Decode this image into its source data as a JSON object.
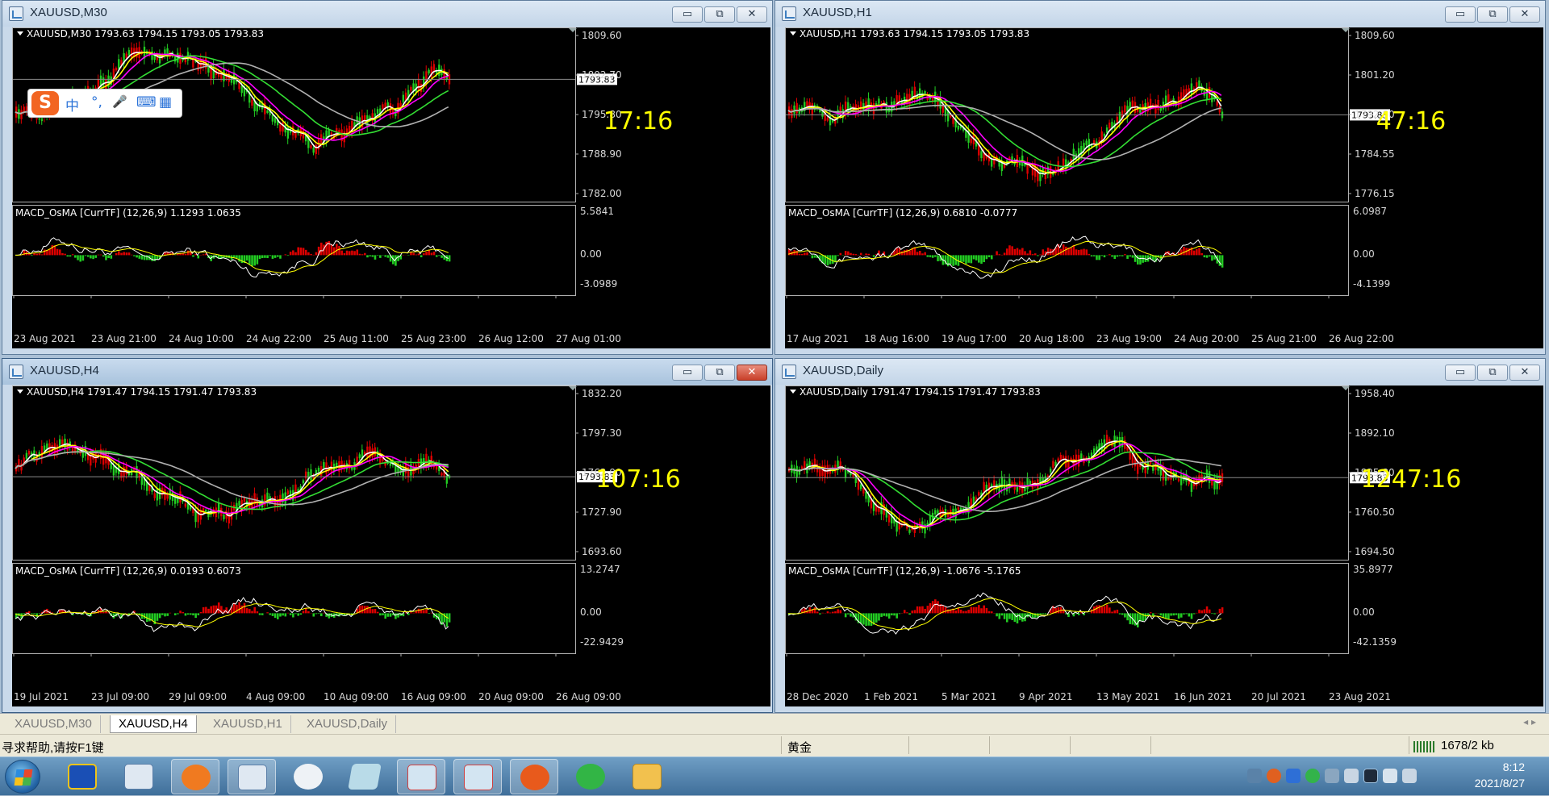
{
  "windows": [
    {
      "id": "m30",
      "title": "XAUUSD,M30",
      "active": false,
      "price_header": "XAUUSD,M30  1793.63 1794.15 1793.05 1793.83",
      "countdown": "17:16",
      "price_ticks": [
        "1809.60",
        "1802.70",
        "1795.80",
        "1788.90",
        "1782.00"
      ],
      "current_price": "1793.83",
      "macd_header": "MACD_OsMA [CurrTF] (12,26,9) 1.1293 1.0635",
      "macd_ticks": [
        "5.5841",
        "0.00",
        "-3.0989"
      ],
      "time_labels": [
        "23 Aug 2021",
        "23 Aug 21:00",
        "24 Aug 10:00",
        "24 Aug 22:00",
        "25 Aug 11:00",
        "25 Aug 23:00",
        "26 Aug 12:00",
        "27 Aug 01:00"
      ]
    },
    {
      "id": "h1",
      "title": "XAUUSD,H1",
      "active": false,
      "price_header": "XAUUSD,H1  1793.63 1794.15 1793.05 1793.83",
      "countdown": "47:16",
      "price_ticks": [
        "1809.60",
        "1801.20",
        "1792.80",
        "1784.55",
        "1776.15"
      ],
      "current_price": "1793.83",
      "macd_header": "MACD_OsMA [CurrTF] (12,26,9) 0.6810 -0.0777",
      "macd_ticks": [
        "6.0987",
        "0.00",
        "-4.1399"
      ],
      "time_labels": [
        "17 Aug 2021",
        "18 Aug 16:00",
        "19 Aug 17:00",
        "20 Aug 18:00",
        "23 Aug 19:00",
        "24 Aug 20:00",
        "25 Aug 21:00",
        "26 Aug 22:00"
      ]
    },
    {
      "id": "h4",
      "title": "XAUUSD,H4",
      "active": true,
      "price_header": "XAUUSD,H4  1791.47 1794.15 1791.47 1793.83",
      "countdown": "107:16",
      "price_ticks": [
        "1832.20",
        "1797.30",
        "1762.90",
        "1727.90",
        "1693.60"
      ],
      "current_price": "1793.83",
      "macd_header": "MACD_OsMA [CurrTF] (12,26,9) 0.0193 0.6073",
      "macd_ticks": [
        "13.2747",
        "0.00",
        "-22.9429"
      ],
      "time_labels": [
        "19 Jul 2021",
        "23 Jul 09:00",
        "29 Jul 09:00",
        "4 Aug 09:00",
        "10 Aug 09:00",
        "16 Aug 09:00",
        "20 Aug 09:00",
        "26 Aug 09:00"
      ]
    },
    {
      "id": "daily",
      "title": "XAUUSD,Daily",
      "active": false,
      "price_header": "XAUUSD,Daily  1791.47 1794.15 1791.47 1793.83",
      "countdown": "1247:16",
      "price_ticks": [
        "1958.40",
        "1892.10",
        "1825.80",
        "1760.50",
        "1694.50"
      ],
      "current_price": "1793.83",
      "macd_header": "MACD_OsMA [CurrTF] (12,26,9) -1.0676 -5.1765",
      "macd_ticks": [
        "35.8977",
        "0.00",
        "-42.1359"
      ],
      "time_labels": [
        "28 Dec 2020",
        "1 Feb 2021",
        "5 Mar 2021",
        "9 Apr 2021",
        "13 May 2021",
        "16 Jun 2021",
        "20 Jul 2021",
        "23 Aug 2021"
      ]
    }
  ],
  "window_buttons": {
    "minimize": "▭",
    "restore": "⧉",
    "close": "✕"
  },
  "tabs": [
    {
      "label": "XAUUSD,M30",
      "active": false
    },
    {
      "label": "XAUUSD,H4",
      "active": true
    },
    {
      "label": "XAUUSD,H1",
      "active": false
    },
    {
      "label": "XAUUSD,Daily",
      "active": false
    }
  ],
  "status": {
    "help": "寻求帮助,请按F1键",
    "profile": "黄金",
    "traffic": "1678/2 kb"
  },
  "ime": {
    "logo": "S",
    "lang": "中",
    "punct": "°,",
    "mic": "🎤",
    "keyboard": "⌨",
    "apps": "▦"
  },
  "clock": {
    "time": "8:12",
    "date": "2021/8/27"
  },
  "colors": {
    "bull": "#dd0000",
    "bear": "#22cc22",
    "ma_fast": "#ffffff",
    "ma_yellow": "#ffff00",
    "ma_magenta": "#ff00ff",
    "ma_green": "#33dd33",
    "ma_gray": "#b0b0b0",
    "countdown": "#ffff00"
  }
}
